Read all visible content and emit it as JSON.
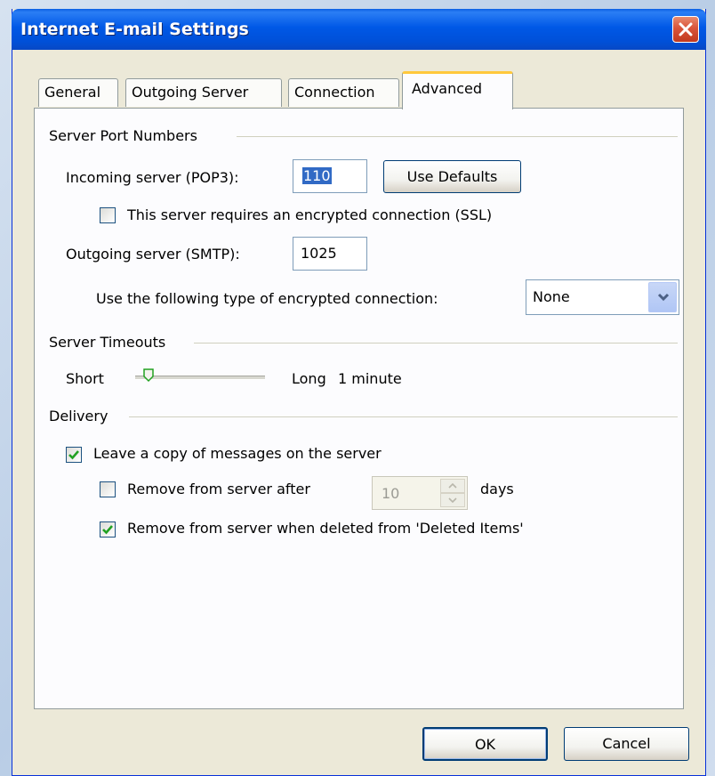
{
  "window": {
    "title": "Internet E-mail Settings"
  },
  "tabs": [
    {
      "label": "General"
    },
    {
      "label": "Outgoing Server"
    },
    {
      "label": "Connection"
    },
    {
      "label": "Advanced",
      "active": true
    }
  ],
  "server_ports": {
    "group_label": "Server Port Numbers",
    "incoming_label": "Incoming server (POP3):",
    "incoming_value": "110",
    "use_defaults_label": "Use Defaults",
    "ssl_label": "This server requires an encrypted connection (SSL)",
    "ssl_checked": false,
    "outgoing_label": "Outgoing server (SMTP):",
    "outgoing_value": "1025",
    "encryption_label": "Use the following type of encrypted connection:",
    "encryption_value": "None"
  },
  "timeouts": {
    "group_label": "Server Timeouts",
    "short_label": "Short",
    "long_label": "Long",
    "value_label": "1 minute",
    "slider_fraction": 0.1
  },
  "delivery": {
    "group_label": "Delivery",
    "leave_copy_label": "Leave a copy of messages on the server",
    "leave_copy_checked": true,
    "remove_after_label": "Remove from server after",
    "remove_after_checked": false,
    "remove_after_days": "10",
    "days_label": "days",
    "remove_deleted_label": "Remove from server when deleted from 'Deleted Items'",
    "remove_deleted_checked": true
  },
  "footer": {
    "ok_label": "OK",
    "cancel_label": "Cancel"
  },
  "colors": {
    "titlebar": "#0058e6",
    "accent_tab": "#ffc83c",
    "check": "#21a121",
    "selection": "#316ac5"
  }
}
